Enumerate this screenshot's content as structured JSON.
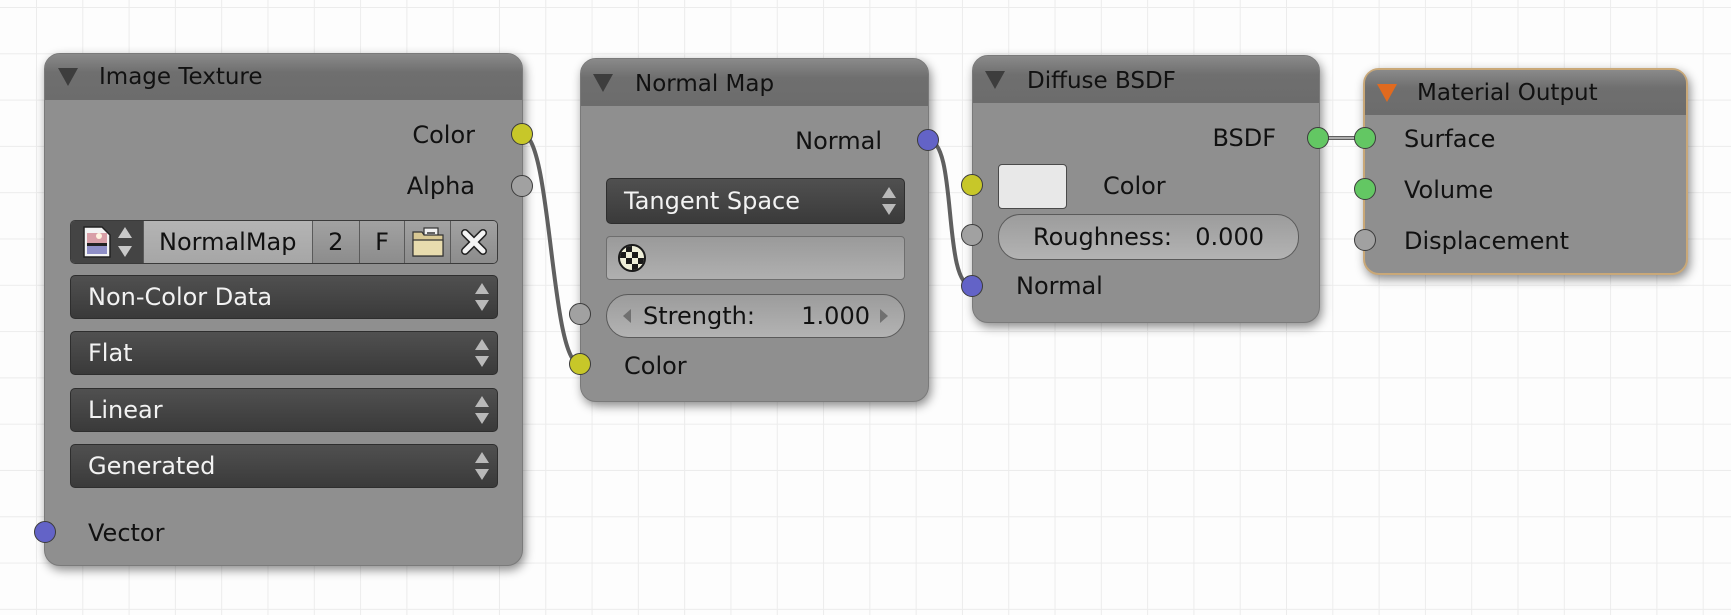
{
  "nodes": {
    "image_texture": {
      "title": "Image Texture",
      "outputs": [
        "Color",
        "Alpha"
      ],
      "image_name": "NormalMap",
      "users_count": "2",
      "fake_user_label": "F",
      "icons": [
        "image-icon",
        "browse-arrows-icon",
        "open-folder-icon",
        "unlink-x-icon"
      ],
      "color_space": "Non-Color Data",
      "projection": "Flat",
      "interpolation": "Linear",
      "source": "Generated",
      "inputs": [
        "Vector"
      ]
    },
    "normal_map": {
      "title": "Normal Map",
      "outputs": [
        "Normal"
      ],
      "space": "Tangent Space",
      "uv_map": "",
      "uv_icon": "uv-checker-icon",
      "strength_label": "Strength:",
      "strength_value": "1.000",
      "inputs": [
        "Color"
      ]
    },
    "diffuse_bsdf": {
      "title": "Diffuse BSDF",
      "outputs": [
        "BSDF"
      ],
      "color_label": "Color",
      "color_value": "#e8e8e8",
      "roughness_label": "Roughness:",
      "roughness_value": "0.000",
      "inputs": [
        "Normal"
      ]
    },
    "material_output": {
      "title": "Material Output",
      "inputs": [
        "Surface",
        "Volume",
        "Displacement"
      ]
    }
  },
  "socket_colors": {
    "color": "#c7c729",
    "float": "#a1a1a1",
    "vector": "#6363c7",
    "shader": "#63c763"
  },
  "active_node_accent": "#e06a1f",
  "links": [
    {
      "from": "Image Texture.Color",
      "to": "Normal Map.Color"
    },
    {
      "from": "Normal Map.Normal",
      "to": "Diffuse BSDF.Normal"
    },
    {
      "from": "Diffuse BSDF.BSDF",
      "to": "Material Output.Surface"
    }
  ]
}
